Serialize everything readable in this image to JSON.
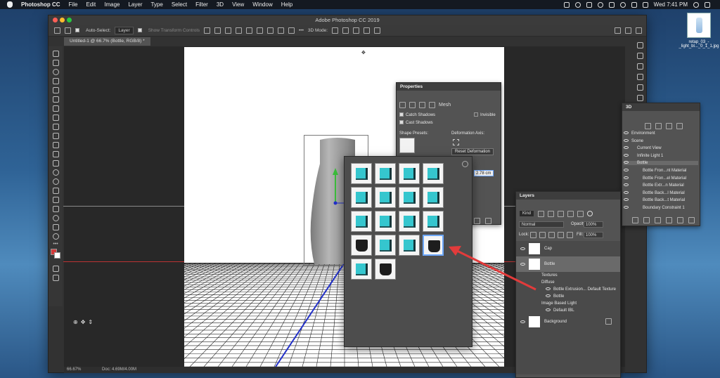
{
  "menubar": {
    "app": "Photoshop CC",
    "items": [
      "File",
      "Edit",
      "Image",
      "Layer",
      "Type",
      "Select",
      "Filter",
      "3D",
      "View",
      "Window",
      "Help"
    ],
    "clock": "Wed 7:41 PM"
  },
  "desktop_file": {
    "name": "retap_03_-_light_bl..._0_1_1.jpg"
  },
  "window": {
    "title": "Adobe Photoshop CC 2019"
  },
  "options": {
    "auto_select_label": "Auto-Select:",
    "auto_select_value": "Layer",
    "show_transform": "Show Transform Controls",
    "mode_label": "3D Mode:"
  },
  "document": {
    "tab": "Untitled-1 @ 66.7% (Bottle, RGB/8) *",
    "zoom": "66.67%",
    "doc_info": "Doc: 4.69M/4.00M"
  },
  "properties": {
    "title": "Properties",
    "mesh_label": "Mesh",
    "catch_shadows": "Catch Shadows",
    "cast_shadows": "Cast Shadows",
    "invisible": "Invisible",
    "shape_presets": "Shape Presets:",
    "deformation_axis": "Deformation Axis:",
    "reset_deformation": "Reset Deformation",
    "depth_value": "2.78 cm"
  },
  "panel3d": {
    "title": "3D",
    "items": [
      {
        "label": "Environment",
        "indent": 0
      },
      {
        "label": "Scene",
        "indent": 0
      },
      {
        "label": "Current View",
        "indent": 1
      },
      {
        "label": "Infinite Light 1",
        "indent": 1
      },
      {
        "label": "Bottle",
        "indent": 1
      },
      {
        "label": "Bottle Fron...nt Material",
        "indent": 2
      },
      {
        "label": "Bottle Fron...el Material",
        "indent": 2
      },
      {
        "label": "Bottle Extr...n Material",
        "indent": 2
      },
      {
        "label": "Bottle Back...l Material",
        "indent": 2
      },
      {
        "label": "Bottle Back...t Material",
        "indent": 2
      },
      {
        "label": "Boundary Constraint 1",
        "indent": 2
      }
    ]
  },
  "layers": {
    "title": "Layers",
    "filter_kind": "Kind",
    "blend_mode": "Normal",
    "opacity_label": "Opacity:",
    "opacity_value": "100%",
    "lock_label": "Lock:",
    "fill_label": "Fill:",
    "fill_value": "100%",
    "rows": [
      {
        "label": "Cap"
      },
      {
        "label": "Bottle"
      },
      {
        "label": "Textures"
      },
      {
        "label": "Diffuse"
      },
      {
        "label": "Bottle Extrusion... Default Texture"
      },
      {
        "label": "Bottle"
      },
      {
        "label": "Image Based Light"
      },
      {
        "label": "Default IBL"
      },
      {
        "label": "Background"
      }
    ]
  },
  "colors": {
    "accent_teal": "#35c6ce",
    "arrow_red": "#e23b3b",
    "axis_green": "#3bbd3b",
    "axis_blue": "#2230c8"
  }
}
